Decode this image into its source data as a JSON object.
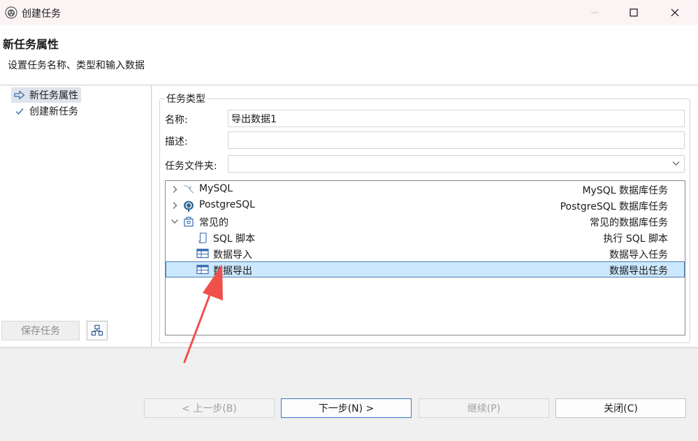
{
  "window": {
    "title": "创建任务",
    "icon": "dbeaver-beaver-icon",
    "controls": [
      "minimize-icon",
      "maximize-icon",
      "close-icon"
    ]
  },
  "header": {
    "title": "新任务属性",
    "description": "设置任务名称、类型和输入数据"
  },
  "steps": [
    {
      "label": "新任务属性",
      "icon": "arrow-right-icon",
      "active": true
    },
    {
      "label": "创建新任务",
      "icon": "check-icon",
      "active": false
    }
  ],
  "left_actions": {
    "save_label": "保存任务",
    "save_enabled": false,
    "extra_icon": "task-tree-icon"
  },
  "form": {
    "group_title": "任务类型",
    "name_label": "名称:",
    "name_value": "导出数据1",
    "desc_label": "描述:",
    "desc_value": "",
    "folder_label": "任务文件夹:",
    "folder_value": ""
  },
  "tree": [
    {
      "label": "MySQL",
      "desc": "MySQL 数据库任务",
      "icon": "mysql-dolphin-icon",
      "level": 0,
      "expanded": false,
      "selected": false
    },
    {
      "label": "PostgreSQL",
      "desc": "PostgreSQL 数据库任务",
      "icon": "postgresql-elephant-icon",
      "level": 0,
      "expanded": false,
      "selected": false
    },
    {
      "label": "常见的",
      "desc": "常见的数据库任务",
      "icon": "package-icon",
      "level": 0,
      "expanded": true,
      "selected": false
    },
    {
      "label": "SQL 脚本",
      "desc": "执行 SQL 脚本",
      "icon": "script-scroll-icon",
      "level": 1,
      "expanded": false,
      "selected": false
    },
    {
      "label": "数据导入",
      "desc": "数据导入任务",
      "icon": "table-import-icon",
      "level": 1,
      "expanded": false,
      "selected": false
    },
    {
      "label": "数据导出",
      "desc": "数据导出任务",
      "icon": "table-export-icon",
      "level": 1,
      "expanded": false,
      "selected": true
    }
  ],
  "footer": {
    "back_label": "< 上一步(B)",
    "next_label": "下一步(N) >",
    "continue_label": "继续(P)",
    "close_label": "关闭(C)"
  },
  "colors": {
    "selection_bg": "#cce8ff",
    "selection_border": "#4a7fb0",
    "accent_button_border": "#3a77c4",
    "annotation_arrow": "#f0504a"
  }
}
